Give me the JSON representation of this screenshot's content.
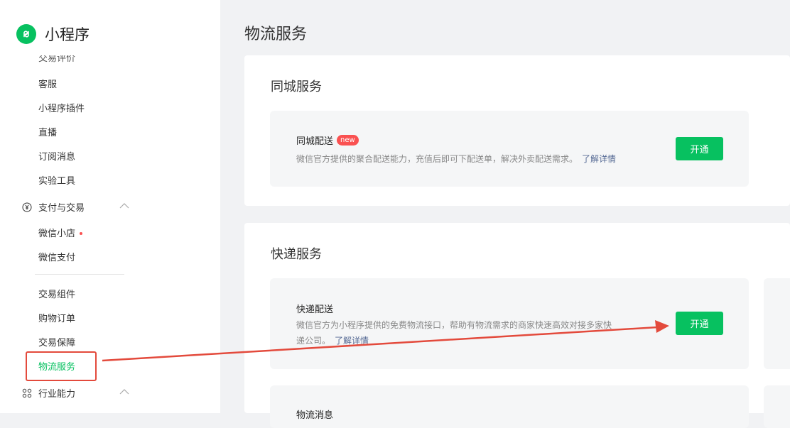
{
  "app": {
    "title": "小程序",
    "logo_icon": "mini-program-icon",
    "brand_color": "#07c160"
  },
  "sidebar": {
    "items_top": [
      {
        "label": "交易评价"
      },
      {
        "label": "客服"
      },
      {
        "label": "小程序插件"
      },
      {
        "label": "直播"
      },
      {
        "label": "订阅消息"
      },
      {
        "label": "实验工具"
      }
    ],
    "group_pay": {
      "label": "支付与交易",
      "icon": "yuan-icon"
    },
    "pay_items": [
      {
        "label": "微信小店"
      },
      {
        "label": "微信支付"
      }
    ],
    "trade_items": [
      {
        "label": "交易组件"
      },
      {
        "label": "购物订单"
      },
      {
        "label": "交易保障"
      },
      {
        "label": "物流服务"
      }
    ],
    "group_industry": {
      "label": "行业能力",
      "icon": "industry-icon"
    }
  },
  "main": {
    "page_title": "物流服务",
    "same_city": {
      "title": "同城服务",
      "card": {
        "title": "同城配送",
        "badge": "new",
        "desc": "微信官方提供的聚合配送能力，充值后即可下配送单，解决外卖配送需求。",
        "link": "了解详情",
        "button": "开通"
      }
    },
    "express": {
      "title": "快递服务",
      "card": {
        "title": "快递配送",
        "desc_line1": "微信官方为小程序提供的免费物流接口，帮助有物流需求的商家快速高效对接多家快",
        "desc_line2": "递公司。",
        "link": "了解详情",
        "button": "开通"
      },
      "next_card_title": "物流消息"
    }
  },
  "annotation_color": "#e34a3c"
}
